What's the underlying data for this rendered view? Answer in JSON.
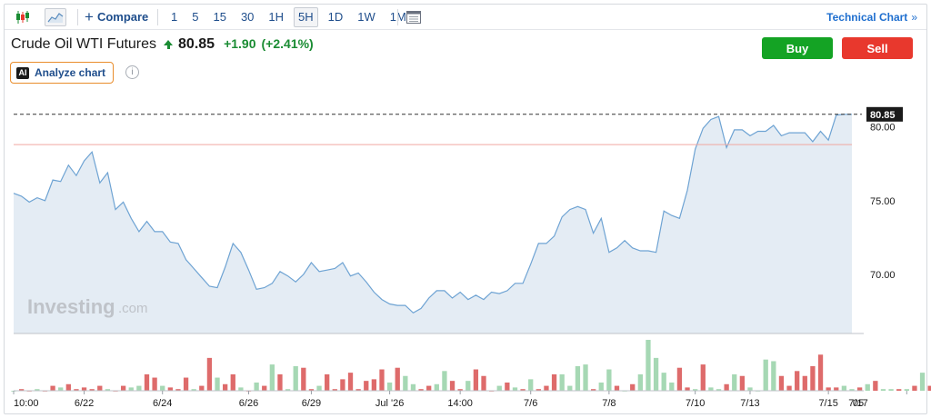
{
  "toolbar": {
    "compare_label": "Compare",
    "intervals": [
      "1",
      "5",
      "15",
      "30",
      "1H",
      "5H",
      "1D",
      "1W",
      "1M"
    ],
    "active_interval": "5H",
    "technical_chart_label": "Technical Chart",
    "technical_chart_chevron": "»"
  },
  "instrument": {
    "name": "Crude Oil WTI Futures",
    "price": "80.85",
    "change": "+1.90",
    "change_pct": "(+2.41%)"
  },
  "actions": {
    "buy_label": "Buy",
    "sell_label": "Sell"
  },
  "analyze_label": "Analyze chart",
  "analyze_badge": "AI",
  "info_glyph": "i",
  "watermark": {
    "main": "Investing",
    "suffix": ".com"
  },
  "colors": {
    "line": "#6ea3d3",
    "area": "#e4ecf4",
    "up_volume": "#a6d8b4",
    "down_volume": "#de6b6b",
    "positive": "#1a8c33",
    "buy": "#14a324",
    "sell": "#e8382d",
    "accent": "#1f4e8c"
  },
  "icons": [
    "candlestick-icon",
    "area-chart-icon",
    "plus-icon",
    "table-icon",
    "chevron-right-icon",
    "arrow-up-icon",
    "info-icon"
  ],
  "chart_data": {
    "type": "area",
    "ylim": [
      66,
      81.7
    ],
    "y_ticks": [
      "80.00",
      "75.00",
      "70.00"
    ],
    "y_tick_values": [
      80,
      75,
      70
    ],
    "last_price": 80.85,
    "last_price_label": "80.85",
    "reference_level": 78.8,
    "x_tick_labels": [
      "10:00",
      "6/22",
      "6/24",
      "6/26",
      "6/29",
      "Jul '26",
      "14:00",
      "7/6",
      "7/8",
      "7/10",
      "7/13",
      "7/15",
      "7/17",
      "05"
    ],
    "x_tick_index": [
      0,
      9,
      19,
      30,
      38,
      48,
      57,
      66,
      76,
      87,
      94,
      104,
      114,
      121
    ],
    "values": [
      75.5,
      75.3,
      74.9,
      75.2,
      75.0,
      76.4,
      76.3,
      77.4,
      76.7,
      77.7,
      78.3,
      76.2,
      76.9,
      74.4,
      74.9,
      73.8,
      72.9,
      73.6,
      72.9,
      72.9,
      72.2,
      72.1,
      71.0,
      70.4,
      69.8,
      69.2,
      69.1,
      70.5,
      72.1,
      71.5,
      70.3,
      69.0,
      69.1,
      69.4,
      70.2,
      69.9,
      69.5,
      70.0,
      70.8,
      70.2,
      70.3,
      70.4,
      70.8,
      69.9,
      70.1,
      69.5,
      68.8,
      68.3,
      68.0,
      67.9,
      67.9,
      67.4,
      67.7,
      68.4,
      68.9,
      68.9,
      68.4,
      68.8,
      68.3,
      68.6,
      68.3,
      68.8,
      68.7,
      68.9,
      69.4,
      69.4,
      70.7,
      72.1,
      72.1,
      72.6,
      73.9,
      74.4,
      74.6,
      74.4,
      72.8,
      73.8,
      71.5,
      71.8,
      72.3,
      71.8,
      71.6,
      71.6,
      71.5,
      74.3,
      74.0,
      73.8,
      75.7,
      78.5,
      79.9,
      80.5,
      80.7,
      78.6,
      79.8,
      79.8,
      79.4,
      79.7,
      79.7,
      80.1,
      79.4,
      79.6,
      79.6,
      79.6,
      79.0,
      79.7,
      79.1,
      80.8,
      80.85,
      80.85
    ],
    "volume": [
      0,
      1,
      0,
      1,
      0,
      3,
      2,
      4,
      1,
      2,
      1,
      3,
      1,
      0,
      3,
      2,
      3,
      10,
      8,
      3,
      2,
      1,
      8,
      1,
      3,
      20,
      8,
      4,
      10,
      2,
      0,
      5,
      3,
      16,
      10,
      1,
      15,
      14,
      1,
      3,
      10,
      1,
      7,
      11,
      1,
      6,
      7,
      13,
      5,
      14,
      9,
      4,
      1,
      3,
      4,
      12,
      6,
      1,
      6,
      13,
      9,
      0,
      3,
      5,
      2,
      1,
      7,
      1,
      3,
      10,
      10,
      3,
      15,
      16,
      1,
      5,
      13,
      3,
      0,
      4,
      10,
      31,
      20,
      11,
      5,
      14,
      2,
      1,
      16,
      2,
      1,
      4,
      10,
      9,
      2,
      0,
      19,
      18,
      9,
      3,
      12,
      9,
      15,
      22,
      2,
      2,
      3,
      1,
      2,
      4,
      6,
      1,
      1,
      1,
      1,
      3,
      11,
      3,
      1,
      0,
      2,
      1
    ],
    "volume_up": [
      1,
      0,
      0,
      1,
      0,
      0,
      1,
      0,
      0,
      0,
      0,
      0,
      1,
      0,
      0,
      1,
      1,
      0,
      0,
      1,
      0,
      0,
      0,
      1,
      0,
      0,
      1,
      0,
      0,
      1,
      0,
      1,
      0,
      1,
      0,
      1,
      1,
      0,
      0,
      1,
      0,
      0,
      0,
      0,
      0,
      0,
      0,
      0,
      1,
      0,
      1,
      1,
      0,
      0,
      1,
      1,
      0,
      0,
      1,
      0,
      0,
      0,
      1,
      0,
      1,
      0,
      1,
      0,
      0,
      0,
      1,
      1,
      1,
      1,
      0,
      1,
      1,
      0,
      1,
      0,
      1,
      1,
      1,
      1,
      1,
      0,
      0,
      1,
      0,
      1,
      1,
      0,
      1,
      0,
      1,
      1,
      1,
      1,
      0,
      0,
      0,
      0,
      0,
      0,
      0,
      0,
      1,
      1,
      0,
      1,
      0,
      1,
      1,
      0,
      1,
      0,
      1,
      0,
      1,
      0,
      1,
      1
    ]
  }
}
